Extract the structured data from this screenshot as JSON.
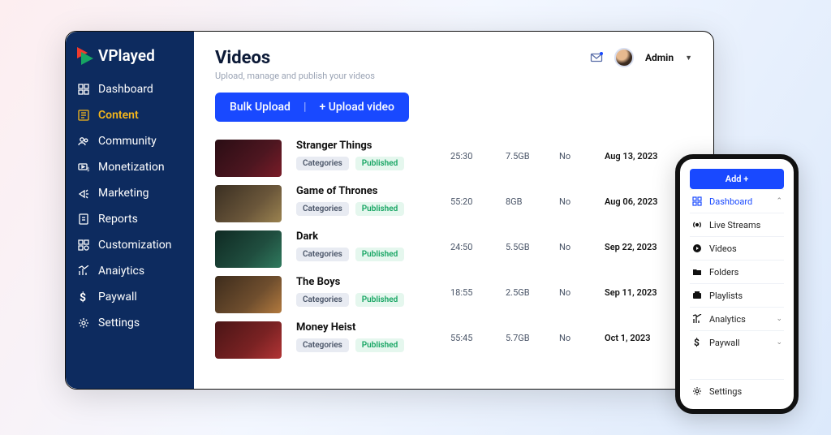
{
  "brand": {
    "name": "VPlayed"
  },
  "sidebar": {
    "items": [
      {
        "label": "Dashboard"
      },
      {
        "label": "Content"
      },
      {
        "label": "Community"
      },
      {
        "label": "Monetization"
      },
      {
        "label": "Marketing"
      },
      {
        "label": "Reports"
      },
      {
        "label": "Customization"
      },
      {
        "label": "Anaiytics"
      },
      {
        "label": "Paywall"
      },
      {
        "label": "Settings"
      }
    ]
  },
  "header": {
    "title": "Videos",
    "subtitle": "Upload, manage and publish your videos",
    "user_role": "Admin"
  },
  "actions": {
    "bulk": "Bulk Upload",
    "upload": "+ Upload video"
  },
  "tags": {
    "categories": "Categories",
    "published": "Published"
  },
  "videos": [
    {
      "title": "Stranger Things",
      "duration": "25:30",
      "size": "7.5GB",
      "flag": "No",
      "date": "Aug 13, 2023"
    },
    {
      "title": "Game of Thrones",
      "duration": "55:20",
      "size": "8GB",
      "flag": "No",
      "date": "Aug 06, 2023"
    },
    {
      "title": "Dark",
      "duration": "24:50",
      "size": "5.5GB",
      "flag": "No",
      "date": "Sep 22, 2023"
    },
    {
      "title": "The Boys",
      "duration": "18:55",
      "size": "2.5GB",
      "flag": "No",
      "date": "Sep 11, 2023"
    },
    {
      "title": "Money Heist",
      "duration": "55:45",
      "size": "5.7GB",
      "flag": "No",
      "date": "Oct 1, 2023"
    }
  ],
  "mobile": {
    "add": "Add +",
    "items": [
      {
        "label": "Dashboard",
        "caret": true,
        "active": true
      },
      {
        "label": "Live Streams"
      },
      {
        "label": "Videos"
      },
      {
        "label": "Folders"
      },
      {
        "label": "Playlists"
      },
      {
        "label": "Analytics",
        "caret": true
      },
      {
        "label": "Paywall",
        "caret": true
      }
    ],
    "settings": "Settings"
  }
}
